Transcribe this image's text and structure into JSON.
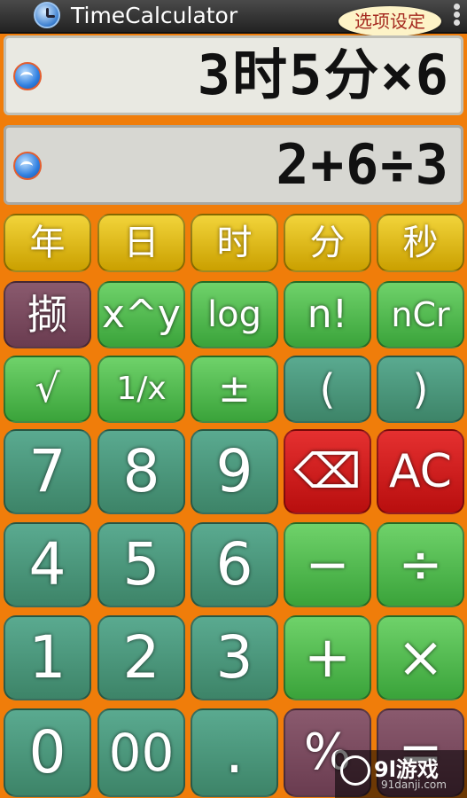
{
  "titlebar": {
    "app_title": "TimeCalculator",
    "options_label": "选项设定"
  },
  "display": {
    "main_expression": "3时5分×6",
    "secondary_expression": "2+6÷3"
  },
  "keypad": {
    "units": [
      "年",
      "日",
      "时",
      "分",
      "秒"
    ],
    "row2": [
      "撷",
      "x^y",
      "log",
      "n!",
      "nCr"
    ],
    "row3": [
      "√",
      "1/x",
      "±",
      "(",
      ")"
    ],
    "row4": [
      "7",
      "8",
      "9",
      "⌫",
      "AC"
    ],
    "row5": [
      "4",
      "5",
      "6",
      "−",
      "÷"
    ],
    "row6": [
      "1",
      "2",
      "3",
      "+",
      "×"
    ],
    "row7": [
      "0",
      "00",
      ".",
      "%",
      "="
    ]
  },
  "watermark": {
    "main": "9l游戏",
    "sub": "91danji.com"
  },
  "colors": {
    "background": "#f07d0a",
    "unit_key": "#e6c41f",
    "green_key": "#55bf52",
    "teal_key": "#4a9a7e",
    "red_key": "#cf1d1d",
    "mauve_key": "#7a4a5f"
  }
}
